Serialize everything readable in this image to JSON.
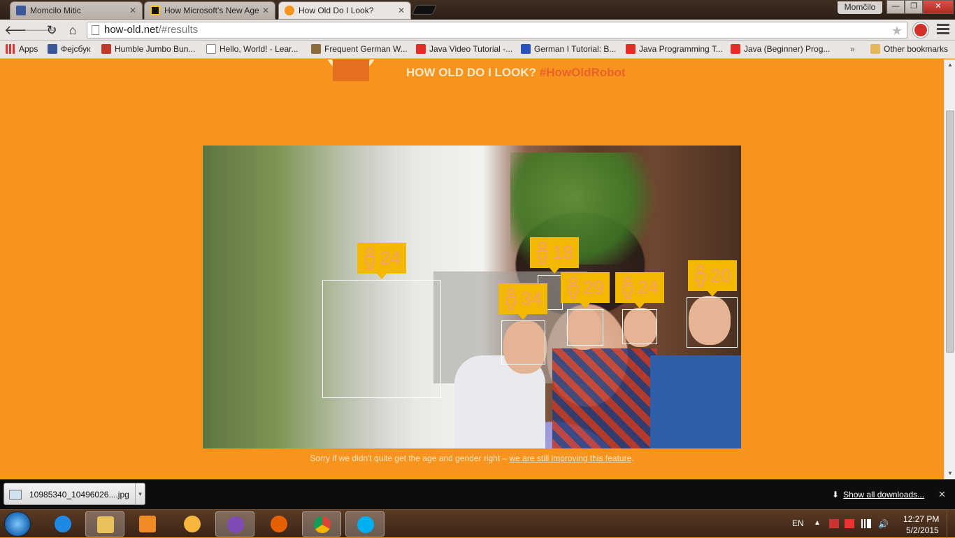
{
  "browser": {
    "tabs": [
      {
        "label": "Momcilo Mitic",
        "favicon_color": "#3b5998"
      },
      {
        "label": "How Microsoft's New Age",
        "favicon_color": "#f5c518"
      },
      {
        "label": "How Old Do I Look?",
        "favicon_color": "#f7941d"
      }
    ],
    "profile_name": "Momčilo",
    "window_buttons": {
      "minimize": "—",
      "maximize": "❐",
      "close": "✕"
    },
    "url_host": "how-old.net",
    "url_path": "/#results",
    "bookmarks": [
      {
        "label": "Apps",
        "icon_color": "#d33"
      },
      {
        "label": "Фејсбук",
        "icon_color": "#3b5998"
      },
      {
        "label": "Humble Jumbo Bun...",
        "icon_color": "#c0392b"
      },
      {
        "label": "Hello, World! - Lear...",
        "icon_color": "#ffffff"
      },
      {
        "label": "Frequent German W...",
        "icon_color": "#8a6d3b"
      },
      {
        "label": "Java Video Tutorial -...",
        "icon_color": "#e52d27"
      },
      {
        "label": "German I Tutorial: B...",
        "icon_color": "#2a52be"
      },
      {
        "label": "Java Programming T...",
        "icon_color": "#e52d27"
      },
      {
        "label": "Java (Beginner) Prog...",
        "icon_color": "#e52d27"
      }
    ],
    "bookmarks_more": "»",
    "other_bookmarks": "Other bookmarks"
  },
  "page": {
    "tagline": "HOW OLD DO I LOOK?",
    "hashtag": "#HowOldRobot",
    "faces": [
      {
        "age": "24",
        "gender": "male"
      },
      {
        "age": "18",
        "gender": "male"
      },
      {
        "age": "34",
        "gender": "male"
      },
      {
        "age": "29",
        "gender": "male"
      },
      {
        "age": "24",
        "gender": "male"
      },
      {
        "age": "20",
        "gender": "male"
      }
    ],
    "sorry_text": "Sorry if we didn't quite get the age and gender right – ",
    "sorry_link": "we are still improving this feature",
    "sorry_end": "."
  },
  "downloads": {
    "file_name": "10985340_10496026....jpg",
    "show_all": "Show all downloads...",
    "close": "✕"
  },
  "taskbar": {
    "apps": [
      {
        "name": "internet-explorer",
        "color": "#1e88e5"
      },
      {
        "name": "file-explorer",
        "color": "#e8c15a"
      },
      {
        "name": "media-player",
        "color": "#f08a24"
      },
      {
        "name": "messenger",
        "color": "#f6b73c"
      },
      {
        "name": "viber",
        "color": "#7d4cb6"
      },
      {
        "name": "firefox",
        "color": "#e66000"
      },
      {
        "name": "chrome",
        "color": "#4caf50"
      },
      {
        "name": "skype",
        "color": "#00aff0"
      }
    ],
    "language": "EN",
    "time": "12:27 PM",
    "date": "5/2/2015"
  }
}
